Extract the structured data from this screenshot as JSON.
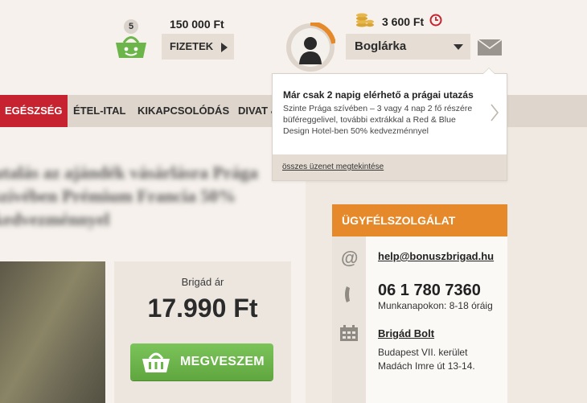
{
  "header": {
    "cart_count": "5",
    "cart_total": "150 000 Ft",
    "pay_label": "FIZETEK",
    "balance": "3 600 Ft",
    "user_name": "Boglárka"
  },
  "nav": {
    "items": [
      {
        "label": "EGÉSZSÉG",
        "active": true
      },
      {
        "label": "ÉTEL-ITAL"
      },
      {
        "label": "KIKAPCSOLÓDÁS"
      },
      {
        "label": "DIVAT &"
      }
    ]
  },
  "message_popup": {
    "title": "Már csak 2 napig elérhető a prágai utazás",
    "text": "Szinte Prága szívében – 3 vagy 4 nap 2 fő részére büféreggelivel, további extrákkal a Red & Blue Design Hotel-ben 50% kedvezménnyel",
    "all_messages_link": "összes üzenet megtekintése"
  },
  "deal": {
    "title_blurred": "utalás az ajándék vásárlásra Prága szívében Prémium Francia 50% kedvezménnyel",
    "price_label": "Brigád ár",
    "price": "17.990 Ft",
    "buy_label": "MEGVESZEM"
  },
  "customer_service": {
    "header": "ÜGYFÉLSZOLGÁLAT",
    "email": "help@bonuszbrigad.hu",
    "phone": "06 1 780 7360",
    "hours": "Munkanapokon: 8-18 óráig",
    "shop_name": "Brigád Bolt",
    "address_line1": "Budapest VII. kerület",
    "address_line2": "Madách Imre út 13-14."
  },
  "colors": {
    "accent_red": "#c7222f",
    "accent_orange": "#e6892b",
    "buy_green": "#6bb54a"
  }
}
